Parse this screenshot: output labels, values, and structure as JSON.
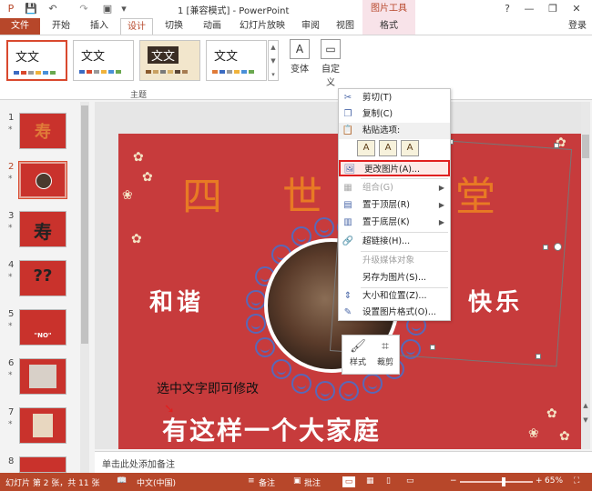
{
  "titlebar": {
    "title": "1 [兼容模式] - PowerPoint",
    "picture_tools": "图片工具",
    "help": "?",
    "minimize": "—",
    "restore": "❐",
    "close": "✕"
  },
  "tabs": [
    {
      "label": "文件"
    },
    {
      "label": "开始"
    },
    {
      "label": "插入"
    },
    {
      "label": "设计"
    },
    {
      "label": "切换"
    },
    {
      "label": "动画"
    },
    {
      "label": "幻灯片放映"
    },
    {
      "label": "审阅"
    },
    {
      "label": "视图"
    },
    {
      "label": "格式"
    }
  ],
  "login": "登录",
  "ribbon": {
    "theme_text": "文文",
    "group_theme": "主题",
    "variant": "变体",
    "custom_line1": "自定",
    "custom_line2": "义"
  },
  "thumbnails": [
    {
      "num": "1",
      "text": "寿"
    },
    {
      "num": "2",
      "text": ""
    },
    {
      "num": "3",
      "text": "寿"
    },
    {
      "num": "4",
      "text": "??"
    },
    {
      "num": "5",
      "text": "\"NO\""
    },
    {
      "num": "6",
      "text": ""
    },
    {
      "num": "7",
      "text": ""
    },
    {
      "num": "8",
      "text": ""
    }
  ],
  "slide": {
    "title_chars": [
      "四",
      "世",
      "堂"
    ],
    "left_word": "和谐",
    "right_word": "快乐",
    "annotation": "选中文字即可修改",
    "bottom_title": "有这样一个大家庭"
  },
  "context_menu": {
    "items": [
      {
        "label": "剪切(T)",
        "icon": "✂"
      },
      {
        "label": "复制(C)",
        "icon": "❐"
      },
      {
        "label": "粘贴选项:",
        "icon": "📋"
      },
      {
        "label": "更改图片(A)...",
        "icon": "🖼"
      },
      {
        "label": "组合(G)",
        "icon": "▦"
      },
      {
        "label": "置于顶层(R)",
        "icon": "▤"
      },
      {
        "label": "置于底层(K)",
        "icon": "▥"
      },
      {
        "label": "超链接(H)...",
        "icon": "🔗"
      },
      {
        "label": "升级媒体对象",
        "icon": ""
      },
      {
        "label": "另存为图片(S)...",
        "icon": ""
      },
      {
        "label": "大小和位置(Z)...",
        "icon": "⇕"
      },
      {
        "label": "设置图片格式(O)...",
        "icon": "✎"
      }
    ],
    "paste_icons": [
      "A",
      "A",
      "A"
    ]
  },
  "mini_toolbar": {
    "style_label": "样式",
    "crop_label": "裁剪"
  },
  "notes_placeholder": "单击此处添加备注",
  "status": {
    "slide_info": "幻灯片 第 2 张，共 11 张",
    "language": "中文(中国)",
    "notes": "备注",
    "comments": "批注",
    "zoom": "65%"
  }
}
